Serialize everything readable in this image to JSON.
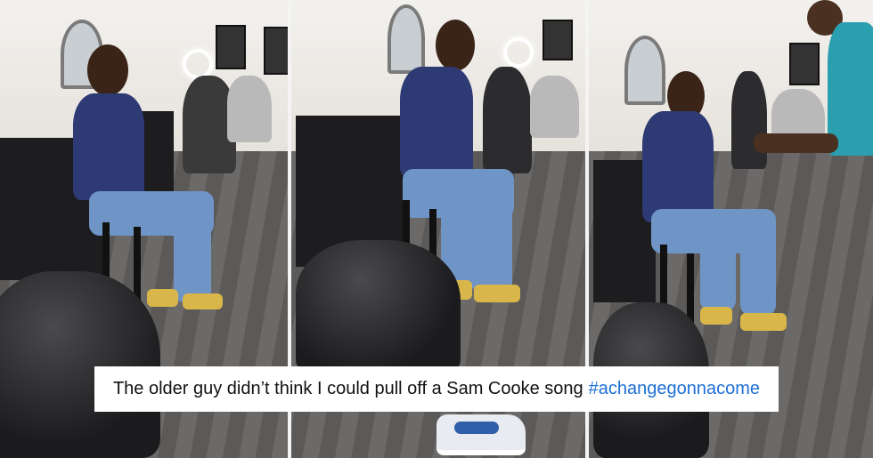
{
  "caption": {
    "text": "The older guy didn’t think I could pull off a Sam Cooke song",
    "hashtag": "#achangegonnacome",
    "hashtag_color": "#1d6fd6"
  },
  "colors": {
    "shirt": "#2e3a73",
    "jeans": "#6f94c6",
    "floor": "#6c6a68",
    "cape": "#1b1b1d"
  }
}
